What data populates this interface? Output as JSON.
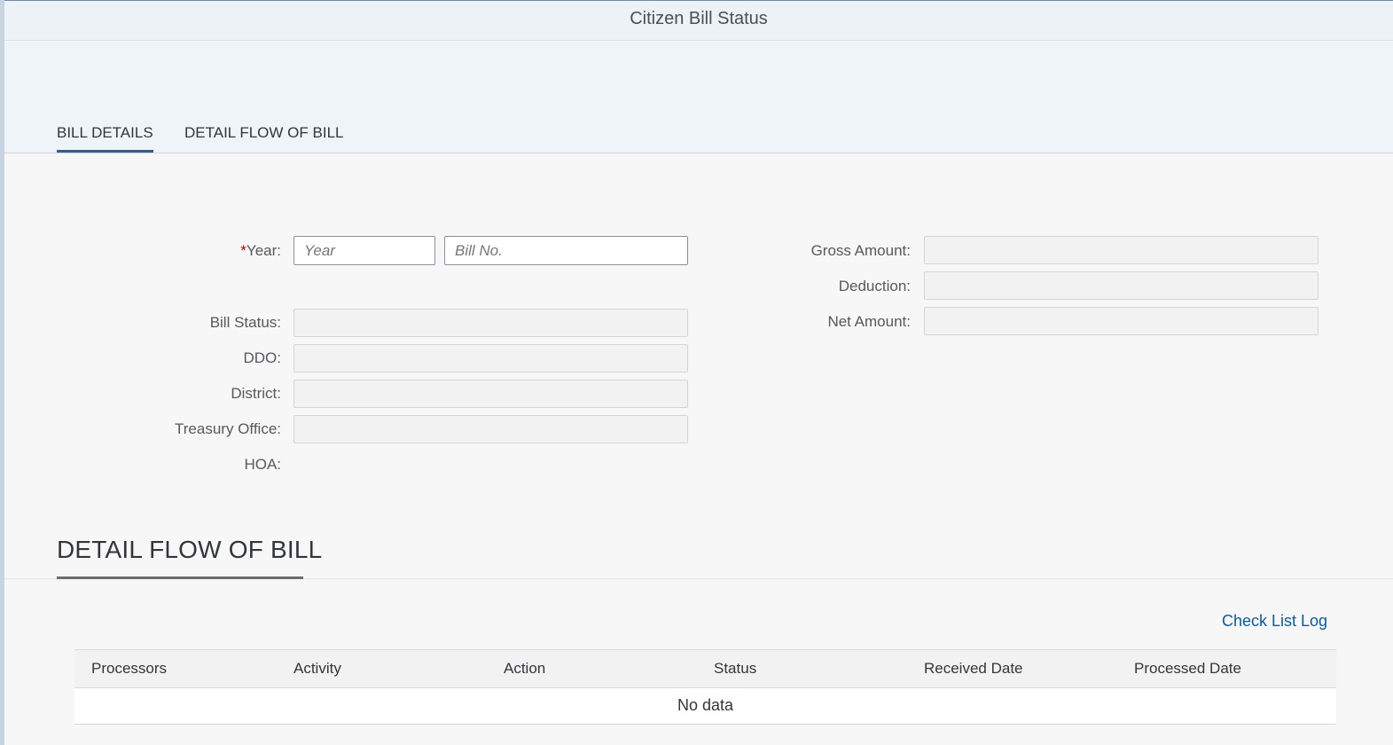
{
  "app": {
    "title": "Citizen Bill Status"
  },
  "tabs": [
    {
      "label": "BILL DETAILS",
      "selected": true
    },
    {
      "label": "DETAIL FLOW OF BILL",
      "selected": false
    }
  ],
  "form": {
    "required_marker": "*",
    "year": {
      "label": "Year:",
      "placeholder": "Year",
      "value": ""
    },
    "bill_no": {
      "placeholder": "Bill No.",
      "value": ""
    },
    "bill_status": {
      "label": "Bill Status:",
      "value": ""
    },
    "ddo": {
      "label": "DDO:",
      "value": ""
    },
    "district": {
      "label": "District:",
      "value": ""
    },
    "treasury_office": {
      "label": "Treasury Office:",
      "value": ""
    },
    "hoa": {
      "label": "HOA:",
      "value": ""
    },
    "gross_amount": {
      "label": "Gross Amount:",
      "value": ""
    },
    "deduction": {
      "label": "Deduction:",
      "value": ""
    },
    "net_amount": {
      "label": "Net Amount:",
      "value": ""
    }
  },
  "flow_section": {
    "title": "DETAIL FLOW OF BILL",
    "check_list_link": "Check List Log",
    "table": {
      "columns": [
        "Processors",
        "Activity",
        "Action",
        "Status",
        "Received Date",
        "Processed Date"
      ],
      "empty_text": "No data"
    }
  },
  "colors": {
    "accent": "#345f8a",
    "link": "#0a5a9e",
    "required": "#bb0000"
  }
}
